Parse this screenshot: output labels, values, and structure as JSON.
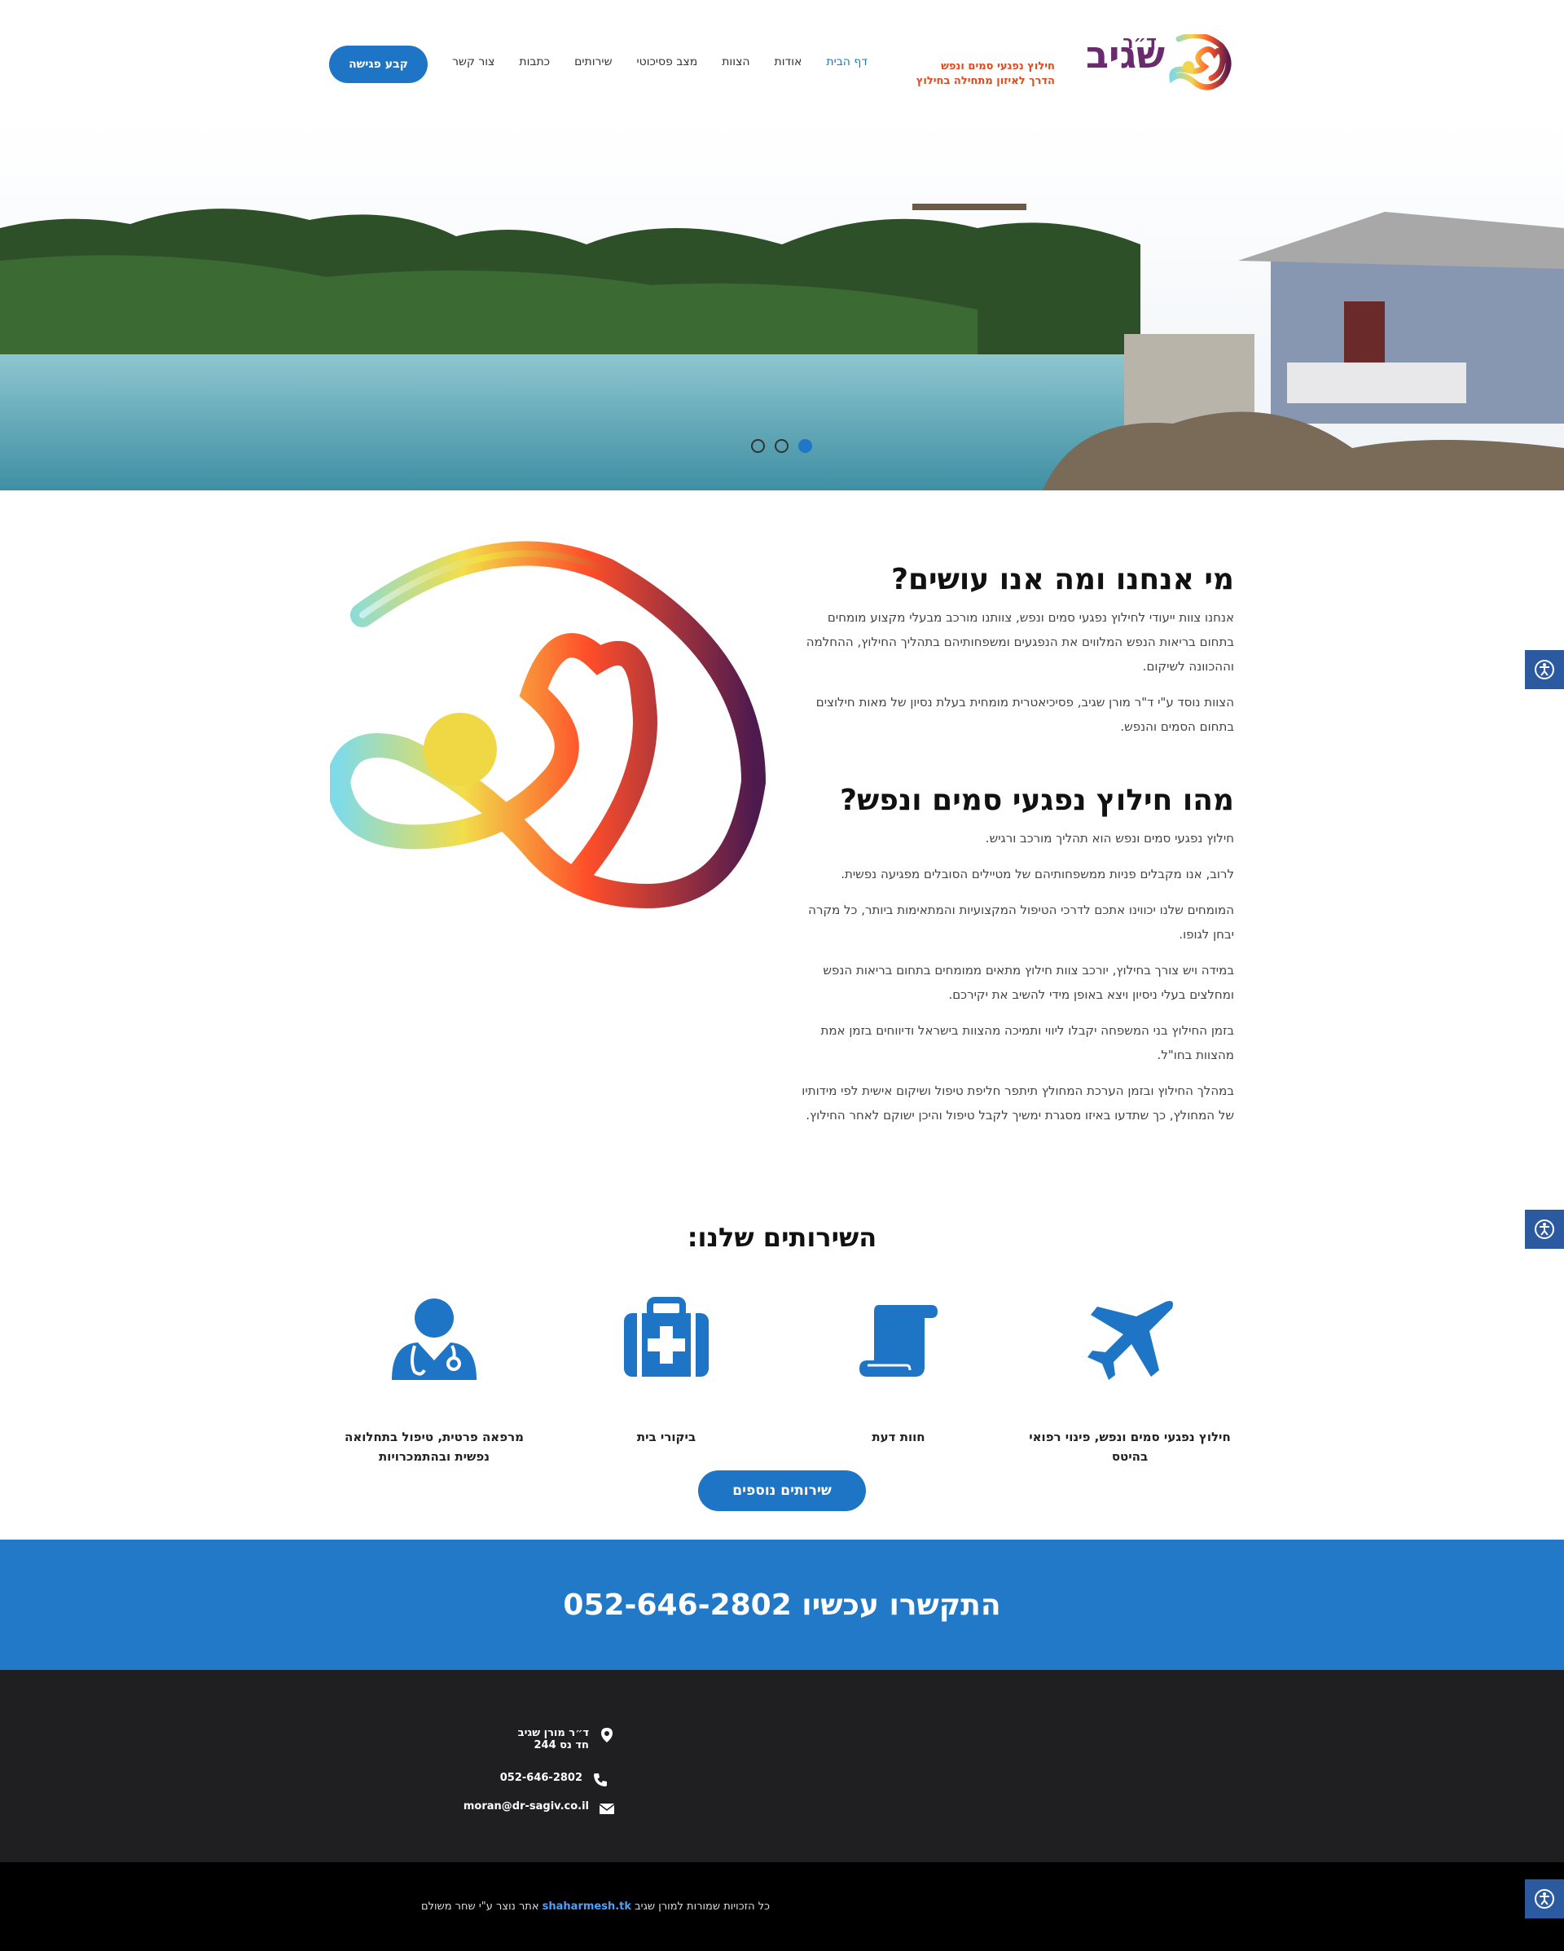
{
  "header": {
    "logo": {
      "dr": "ד״ר",
      "name": "שגיב",
      "tagline1": "חילוץ נפגעי סמים ונפש",
      "tagline2": "הדרך לאיזון מתחילה בחילוץ"
    },
    "nav": [
      "דף הבית",
      "אודות",
      "הצוות",
      "מצב פסיכוטי",
      "שירותים",
      "כתבות",
      "צור קשר"
    ],
    "cta": "קבע פגישה"
  },
  "about": {
    "title1": "מי אנחנו ומה אנו עושים?",
    "p1": "אנחנו צוות ייעודי לחילוץ נפגעי סמים ונפש, צוותנו מורכב מבעלי מקצוע מומחים בתחום בריאות הנפש המלווים את הנפגעים ומשפחותיהם בתהליך החילוץ, ההחלמה וההכוונה לשיקום.",
    "p2": "הצוות נוסד ע\"י ד\"ר מורן שגיב, פסיכיאטרית מומחית בעלת נסיון של מאות חילוצים בתחום הסמים והנפש.",
    "title2": "מהו חילוץ נפגעי סמים ונפש?",
    "p3": "חילוץ נפגעי סמים ונפש הוא תהליך מורכב ורגיש.",
    "p4": "לרוב, אנו מקבלים פניות ממשפחותיהם של מטיילים הסובלים מפגיעה נפשית.",
    "p5": "המומחים שלנו יכווינו אתכם לדרכי הטיפול המקצועיות והמתאימות ביותר, כל מקרה יבחן לגופו.",
    "p6": "במידה ויש צורך בחילוץ, יורכב צוות חילוץ מתאים ממומחים בתחום בריאות הנפש ומחלצים בעלי ניסיון ויצא באופן מידי להשיב את יקירכם.",
    "p7": "בזמן החילוץ בני המשפחה יקבלו ליווי ותמיכה מהצוות בישראל ודיווחים בזמן אמת מהצוות בחו\"ל.",
    "p8": "במהלך החילוץ ובזמן הערכת המחולץ תיתפר חליפת טיפול ושיקום אישית לפי מידותיו של המחולץ, כך שתדעו באיזו מסגרת ימשיך לקבל טיפול והיכן ישוקם לאחר החילוץ."
  },
  "services": {
    "title": "השירותים שלנו:",
    "items": [
      {
        "label": "חילוץ נפגעי סמים ונפש, פינוי רפואי בהיטס",
        "icon": "airplane-icon"
      },
      {
        "label": "חוות דעת",
        "icon": "scroll-icon"
      },
      {
        "label": "ביקורי בית",
        "icon": "first-aid-kit-icon"
      },
      {
        "label": "מרפאה פרטית, טיפול בתחלואה נפשית ובהתמכרויות",
        "icon": "doctor-icon"
      }
    ],
    "more": "שירותים נוספים"
  },
  "band": {
    "text": "התקשרו עכשיו 052-646-2802"
  },
  "footer": {
    "address_name": "ד״ר מורן שגיב",
    "address_line": "חד נס 244",
    "phone": "052-646-2802",
    "email": "moran@dr-sagiv.co.il",
    "copyright_pre": "כל הזכויות שמורות למורן שגיב",
    "copyright_link": "shaharmesh.tk",
    "copyright_post": "אתר נוצר ע\"י שחר משולם"
  },
  "colors": {
    "accent": "#1e74c5",
    "band": "#2279c7",
    "footer": "#1f1f21",
    "bottom": "#000000"
  }
}
